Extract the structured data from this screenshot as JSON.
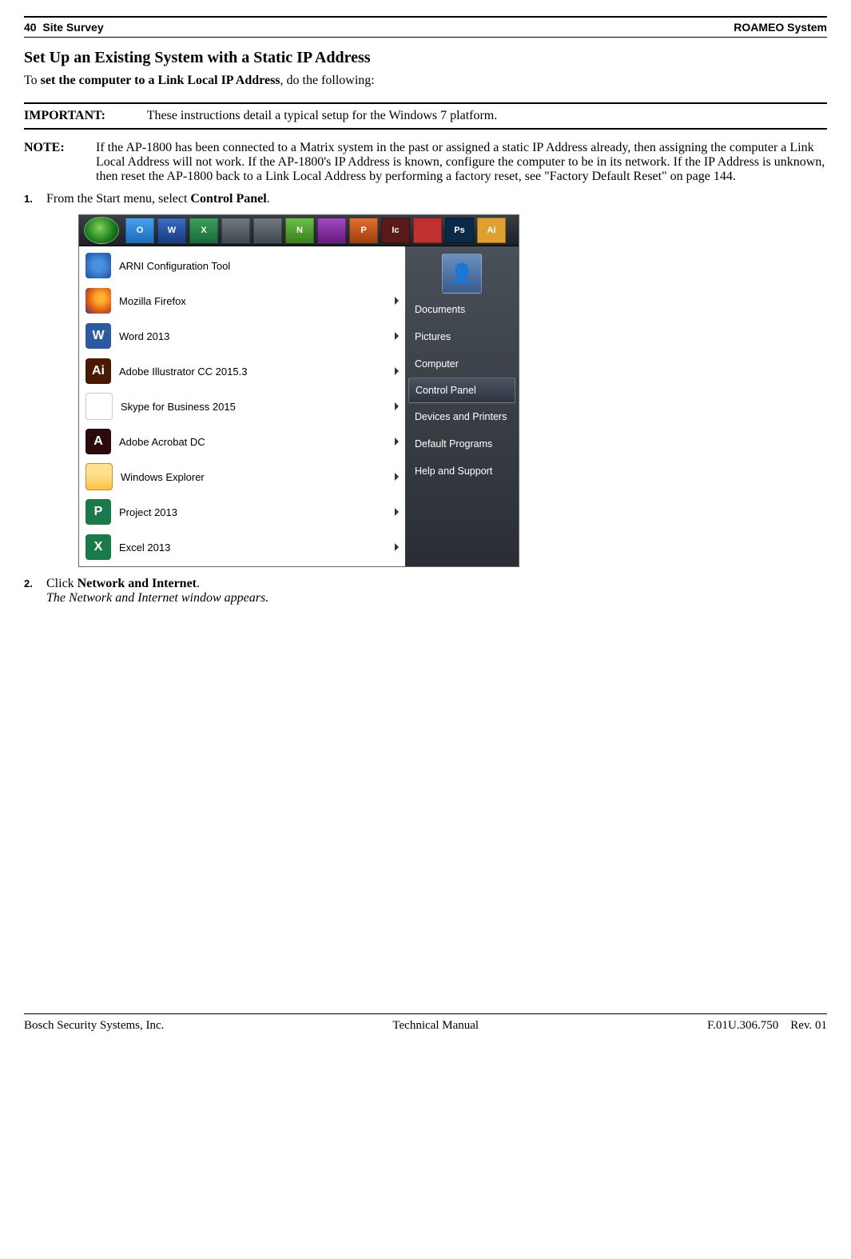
{
  "header": {
    "page_num": "40",
    "section": "Site Survey",
    "product": "ROAMEO System"
  },
  "title": "Set Up an Existing System with a Static IP Address",
  "lead_pre": "To ",
  "lead_bold": "set the computer to a Link Local IP Address",
  "lead_post": ", do the following:",
  "important": {
    "label": "IMPORTANT:",
    "text": "These instructions detail a typical setup for the Windows 7 platform."
  },
  "note": {
    "label": "NOTE:",
    "text": "If the AP-1800 has been connected to a Matrix system in the past or assigned a static IP Address already, then assigning the computer a Link Local Address will not work. If the AP-1800's IP Address is known, configure the computer to be in its network. If the IP Address is unknown, then reset the AP-1800 back to a Link Local Address by performing a factory reset, see \"Factory Default Reset\" on page 144."
  },
  "steps": {
    "s1_num": "1.",
    "s1_pre": "From the Start menu, select ",
    "s1_bold": "Control Panel",
    "s1_post": ".",
    "s2_num": "2.",
    "s2_pre": "Click ",
    "s2_bold": "Network and Internet",
    "s2_post": ".",
    "s2_result": "The Network and Internet window appears"
  },
  "startmenu": {
    "taskbar_pins": [
      "O",
      "W",
      "X",
      "",
      "",
      "N",
      "",
      "P",
      "Ic",
      "",
      "Ps",
      "Ai"
    ],
    "left_items": [
      {
        "label": "ARNI Configuration Tool",
        "arrow": false
      },
      {
        "label": "Mozilla Firefox",
        "arrow": true
      },
      {
        "label": "Word 2013",
        "arrow": true
      },
      {
        "label": "Adobe Illustrator CC 2015.3",
        "arrow": true
      },
      {
        "label": "Skype for Business 2015",
        "arrow": true
      },
      {
        "label": "Adobe Acrobat DC",
        "arrow": true
      },
      {
        "label": "Windows Explorer",
        "arrow": true
      },
      {
        "label": "Project 2013",
        "arrow": true
      },
      {
        "label": "Excel 2013",
        "arrow": true
      }
    ],
    "right_items": [
      {
        "label": "Documents",
        "selected": false
      },
      {
        "label": "Pictures",
        "selected": false
      },
      {
        "label": "Computer",
        "selected": false
      },
      {
        "label": "Control Panel",
        "selected": true
      },
      {
        "label": "Devices and Printers",
        "selected": false
      },
      {
        "label": "Default Programs",
        "selected": false
      },
      {
        "label": "Help and Support",
        "selected": false
      }
    ]
  },
  "footer": {
    "left": "Bosch Security Systems, Inc.",
    "center": "Technical Manual",
    "docnum": "F.01U.306.750",
    "rev": "Rev. 01"
  }
}
